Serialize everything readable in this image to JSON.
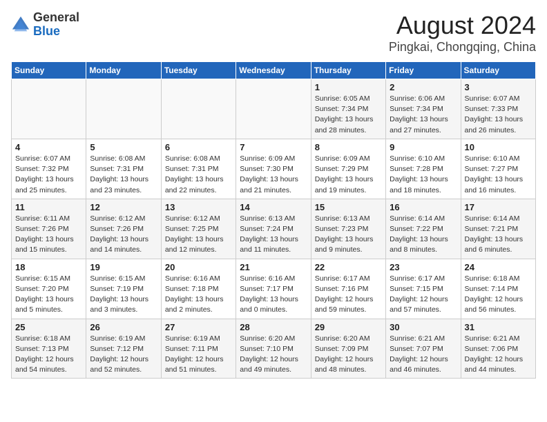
{
  "logo": {
    "general": "General",
    "blue": "Blue"
  },
  "title": "August 2024",
  "subtitle": "Pingkai, Chongqing, China",
  "days_of_week": [
    "Sunday",
    "Monday",
    "Tuesday",
    "Wednesday",
    "Thursday",
    "Friday",
    "Saturday"
  ],
  "weeks": [
    [
      {
        "day": "",
        "info": ""
      },
      {
        "day": "",
        "info": ""
      },
      {
        "day": "",
        "info": ""
      },
      {
        "day": "",
        "info": ""
      },
      {
        "day": "1",
        "info": "Sunrise: 6:05 AM\nSunset: 7:34 PM\nDaylight: 13 hours\nand 28 minutes."
      },
      {
        "day": "2",
        "info": "Sunrise: 6:06 AM\nSunset: 7:34 PM\nDaylight: 13 hours\nand 27 minutes."
      },
      {
        "day": "3",
        "info": "Sunrise: 6:07 AM\nSunset: 7:33 PM\nDaylight: 13 hours\nand 26 minutes."
      }
    ],
    [
      {
        "day": "4",
        "info": "Sunrise: 6:07 AM\nSunset: 7:32 PM\nDaylight: 13 hours\nand 25 minutes."
      },
      {
        "day": "5",
        "info": "Sunrise: 6:08 AM\nSunset: 7:31 PM\nDaylight: 13 hours\nand 23 minutes."
      },
      {
        "day": "6",
        "info": "Sunrise: 6:08 AM\nSunset: 7:31 PM\nDaylight: 13 hours\nand 22 minutes."
      },
      {
        "day": "7",
        "info": "Sunrise: 6:09 AM\nSunset: 7:30 PM\nDaylight: 13 hours\nand 21 minutes."
      },
      {
        "day": "8",
        "info": "Sunrise: 6:09 AM\nSunset: 7:29 PM\nDaylight: 13 hours\nand 19 minutes."
      },
      {
        "day": "9",
        "info": "Sunrise: 6:10 AM\nSunset: 7:28 PM\nDaylight: 13 hours\nand 18 minutes."
      },
      {
        "day": "10",
        "info": "Sunrise: 6:10 AM\nSunset: 7:27 PM\nDaylight: 13 hours\nand 16 minutes."
      }
    ],
    [
      {
        "day": "11",
        "info": "Sunrise: 6:11 AM\nSunset: 7:26 PM\nDaylight: 13 hours\nand 15 minutes."
      },
      {
        "day": "12",
        "info": "Sunrise: 6:12 AM\nSunset: 7:26 PM\nDaylight: 13 hours\nand 14 minutes."
      },
      {
        "day": "13",
        "info": "Sunrise: 6:12 AM\nSunset: 7:25 PM\nDaylight: 13 hours\nand 12 minutes."
      },
      {
        "day": "14",
        "info": "Sunrise: 6:13 AM\nSunset: 7:24 PM\nDaylight: 13 hours\nand 11 minutes."
      },
      {
        "day": "15",
        "info": "Sunrise: 6:13 AM\nSunset: 7:23 PM\nDaylight: 13 hours\nand 9 minutes."
      },
      {
        "day": "16",
        "info": "Sunrise: 6:14 AM\nSunset: 7:22 PM\nDaylight: 13 hours\nand 8 minutes."
      },
      {
        "day": "17",
        "info": "Sunrise: 6:14 AM\nSunset: 7:21 PM\nDaylight: 13 hours\nand 6 minutes."
      }
    ],
    [
      {
        "day": "18",
        "info": "Sunrise: 6:15 AM\nSunset: 7:20 PM\nDaylight: 13 hours\nand 5 minutes."
      },
      {
        "day": "19",
        "info": "Sunrise: 6:15 AM\nSunset: 7:19 PM\nDaylight: 13 hours\nand 3 minutes."
      },
      {
        "day": "20",
        "info": "Sunrise: 6:16 AM\nSunset: 7:18 PM\nDaylight: 13 hours\nand 2 minutes."
      },
      {
        "day": "21",
        "info": "Sunrise: 6:16 AM\nSunset: 7:17 PM\nDaylight: 13 hours\nand 0 minutes."
      },
      {
        "day": "22",
        "info": "Sunrise: 6:17 AM\nSunset: 7:16 PM\nDaylight: 12 hours\nand 59 minutes."
      },
      {
        "day": "23",
        "info": "Sunrise: 6:17 AM\nSunset: 7:15 PM\nDaylight: 12 hours\nand 57 minutes."
      },
      {
        "day": "24",
        "info": "Sunrise: 6:18 AM\nSunset: 7:14 PM\nDaylight: 12 hours\nand 56 minutes."
      }
    ],
    [
      {
        "day": "25",
        "info": "Sunrise: 6:18 AM\nSunset: 7:13 PM\nDaylight: 12 hours\nand 54 minutes."
      },
      {
        "day": "26",
        "info": "Sunrise: 6:19 AM\nSunset: 7:12 PM\nDaylight: 12 hours\nand 52 minutes."
      },
      {
        "day": "27",
        "info": "Sunrise: 6:19 AM\nSunset: 7:11 PM\nDaylight: 12 hours\nand 51 minutes."
      },
      {
        "day": "28",
        "info": "Sunrise: 6:20 AM\nSunset: 7:10 PM\nDaylight: 12 hours\nand 49 minutes."
      },
      {
        "day": "29",
        "info": "Sunrise: 6:20 AM\nSunset: 7:09 PM\nDaylight: 12 hours\nand 48 minutes."
      },
      {
        "day": "30",
        "info": "Sunrise: 6:21 AM\nSunset: 7:07 PM\nDaylight: 12 hours\nand 46 minutes."
      },
      {
        "day": "31",
        "info": "Sunrise: 6:21 AM\nSunset: 7:06 PM\nDaylight: 12 hours\nand 44 minutes."
      }
    ]
  ]
}
